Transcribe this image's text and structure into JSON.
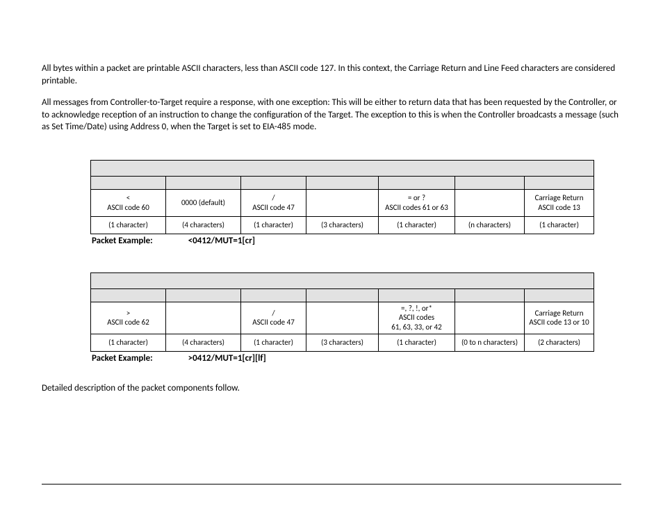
{
  "paragraphs": {
    "p1": "All bytes within a packet are printable ASCII characters, less than ASCII code 127. In this context, the Carriage Return and Line Feed characters are considered printable.",
    "p2": "All messages from Controller-to-Target require a response, with one exception: This will be either to return data that has been requested by the Controller, or to acknowledge reception of an instruction to change the configuration of the Target. The exception to this is when the Controller broadcasts a message (such as Set Time/Date) using Address 0, when the Target is set to EIA-485 mode.",
    "closing": "Detailed description of the packet components follow."
  },
  "table1": {
    "r_vals": [
      "<\nASCII code 60",
      "0000 (default)",
      "/\nASCII code 47",
      "",
      "=  or  ?\nASCII codes 61 or 63",
      "",
      "Carriage Return\nASCII code 13"
    ],
    "r_counts": [
      "(1 character)",
      "(4 characters)",
      "(1 character)",
      "(3 characters)",
      "(1 character)",
      "(n characters)",
      "(1 character)"
    ],
    "example_label": "Packet Example:",
    "example_value": "<0412/MUT=1[cr]"
  },
  "table2": {
    "r_vals": [
      ">\nASCII code 62",
      "",
      "/\nASCII code 47",
      "",
      "=, ?, !, or*\nASCII codes\n61, 63, 33, or 42",
      "",
      "Carriage Return\nASCII code 13 or 10"
    ],
    "r_counts": [
      "(1 character)",
      "(4 characters)",
      "(1 character)",
      "(3 characters)",
      "(1 character)",
      "(0 to n characters)",
      "(2 characters)"
    ],
    "example_label": "Packet Example:",
    "example_value": ">0412/MUT=1[cr][lf]"
  }
}
